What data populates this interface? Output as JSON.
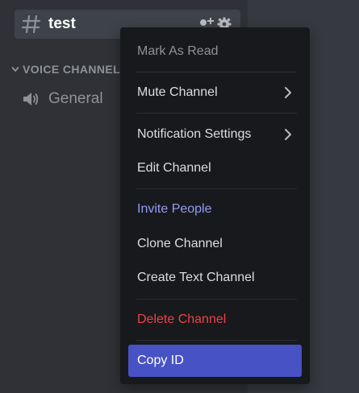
{
  "sidebar": {
    "text_channel": {
      "name": "test",
      "hash_icon": "hash-icon",
      "invite_icon": "add-user-icon",
      "settings_icon": "gear-icon"
    },
    "voice_category": {
      "label": "VOICE CHANNELS",
      "chevron_icon": "chevron-down-icon"
    },
    "voice_channel": {
      "name": "General",
      "icon": "speaker-icon"
    }
  },
  "context_menu": {
    "items": [
      {
        "label": "Mark As Read"
      },
      {
        "label": "Mute Channel",
        "has_submenu": true
      },
      {
        "label": "Notification Settings",
        "has_submenu": true
      },
      {
        "label": "Edit Channel"
      },
      {
        "label": "Invite People"
      },
      {
        "label": "Clone Channel"
      },
      {
        "label": "Create Text Channel"
      },
      {
        "label": "Delete Channel"
      },
      {
        "label": "Copy ID"
      }
    ]
  },
  "colors": {
    "background": "#36393f",
    "sidebar": "#2f3136",
    "menu": "#18191c",
    "accent_blurple": "#4752c4",
    "invite_text": "#949cf7",
    "danger_text": "#ed4245"
  }
}
